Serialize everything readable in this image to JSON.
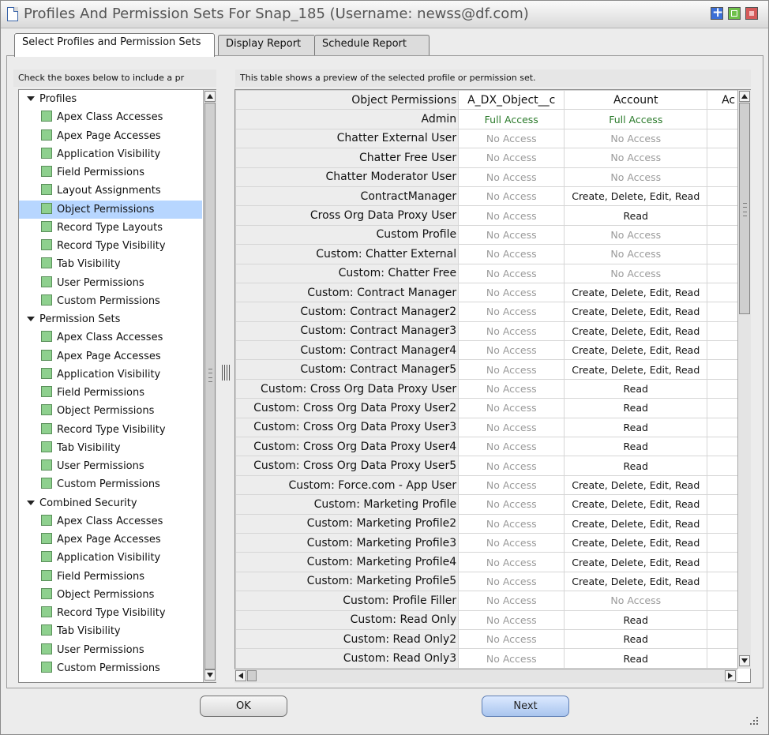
{
  "window": {
    "title": "Profiles And Permission Sets For Snap_185 (Username: newss@df.com)"
  },
  "tabs": [
    {
      "label": "Select Profiles and Permission Sets",
      "active": true
    },
    {
      "label": "Display Report",
      "active": false
    },
    {
      "label": "Schedule Report",
      "active": false
    }
  ],
  "left_hint": "Check the boxes below to include a pr",
  "right_hint": "This table shows a preview of the selected profile or permission set.",
  "tree": {
    "groups": [
      {
        "label": "Profiles",
        "items": [
          "Apex Class Accesses",
          "Apex Page Accesses",
          "Application Visibility",
          "Field Permissions",
          "Layout Assignments",
          "Object Permissions",
          "Record Type Layouts",
          "Record Type Visibility",
          "Tab Visibility",
          "User Permissions",
          "Custom Permissions"
        ]
      },
      {
        "label": "Permission Sets",
        "items": [
          "Apex Class Accesses",
          "Apex Page Accesses",
          "Application Visibility",
          "Field Permissions",
          "Object Permissions",
          "Record Type Visibility",
          "Tab Visibility",
          "User Permissions",
          "Custom Permissions"
        ]
      },
      {
        "label": "Combined Security",
        "items": [
          "Apex Class Accesses",
          "Apex Page Accesses",
          "Application Visibility",
          "Field Permissions",
          "Object Permissions",
          "Record Type Visibility",
          "Tab Visibility",
          "User Permissions",
          "Custom Permissions"
        ]
      }
    ],
    "selected": "Object Permissions"
  },
  "table": {
    "headers": [
      "Object Permissions",
      "A_DX_Object__c",
      "Account",
      "Ac"
    ],
    "rows": [
      [
        "Admin",
        "Full Access",
        "Full Access"
      ],
      [
        "Chatter External User",
        "No Access",
        "No Access"
      ],
      [
        "Chatter Free User",
        "No Access",
        "No Access"
      ],
      [
        "Chatter Moderator User",
        "No Access",
        "No Access"
      ],
      [
        "ContractManager",
        "No Access",
        "Create, Delete, Edit, Read"
      ],
      [
        "Cross Org Data Proxy User",
        "No Access",
        "Read"
      ],
      [
        "Custom Profile",
        "No Access",
        "No Access"
      ],
      [
        "Custom: Chatter External",
        "No Access",
        "No Access"
      ],
      [
        "Custom: Chatter Free",
        "No Access",
        "No Access"
      ],
      [
        "Custom: Contract Manager",
        "No Access",
        "Create, Delete, Edit, Read"
      ],
      [
        "Custom: Contract Manager2",
        "No Access",
        "Create, Delete, Edit, Read"
      ],
      [
        "Custom: Contract Manager3",
        "No Access",
        "Create, Delete, Edit, Read"
      ],
      [
        "Custom: Contract Manager4",
        "No Access",
        "Create, Delete, Edit, Read"
      ],
      [
        "Custom: Contract Manager5",
        "No Access",
        "Create, Delete, Edit, Read"
      ],
      [
        "Custom: Cross Org Data Proxy User",
        "No Access",
        "Read"
      ],
      [
        "Custom: Cross Org Data Proxy User2",
        "No Access",
        "Read"
      ],
      [
        "Custom: Cross Org Data Proxy User3",
        "No Access",
        "Read"
      ],
      [
        "Custom: Cross Org Data Proxy User4",
        "No Access",
        "Read"
      ],
      [
        "Custom: Cross Org Data Proxy User5",
        "No Access",
        "Read"
      ],
      [
        "Custom: Force.com - App User",
        "No Access",
        "Create, Delete, Edit, Read"
      ],
      [
        "Custom: Marketing Profile",
        "No Access",
        "Create, Delete, Edit, Read"
      ],
      [
        "Custom: Marketing Profile2",
        "No Access",
        "Create, Delete, Edit, Read"
      ],
      [
        "Custom: Marketing Profile3",
        "No Access",
        "Create, Delete, Edit, Read"
      ],
      [
        "Custom: Marketing Profile4",
        "No Access",
        "Create, Delete, Edit, Read"
      ],
      [
        "Custom: Marketing Profile5",
        "No Access",
        "Create, Delete, Edit, Read"
      ],
      [
        "Custom: Profile Filler",
        "No Access",
        "No Access"
      ],
      [
        "Custom: Read Only",
        "No Access",
        "Read"
      ],
      [
        "Custom: Read Only2",
        "No Access",
        "Read"
      ],
      [
        "Custom: Read Only3",
        "No Access",
        "Read"
      ]
    ]
  },
  "buttons": {
    "ok": "OK",
    "next": "Next"
  },
  "colors": {
    "full_access": "#2a7a2a",
    "no_access": "#9a9a9a",
    "selection": "#b7d6ff"
  }
}
